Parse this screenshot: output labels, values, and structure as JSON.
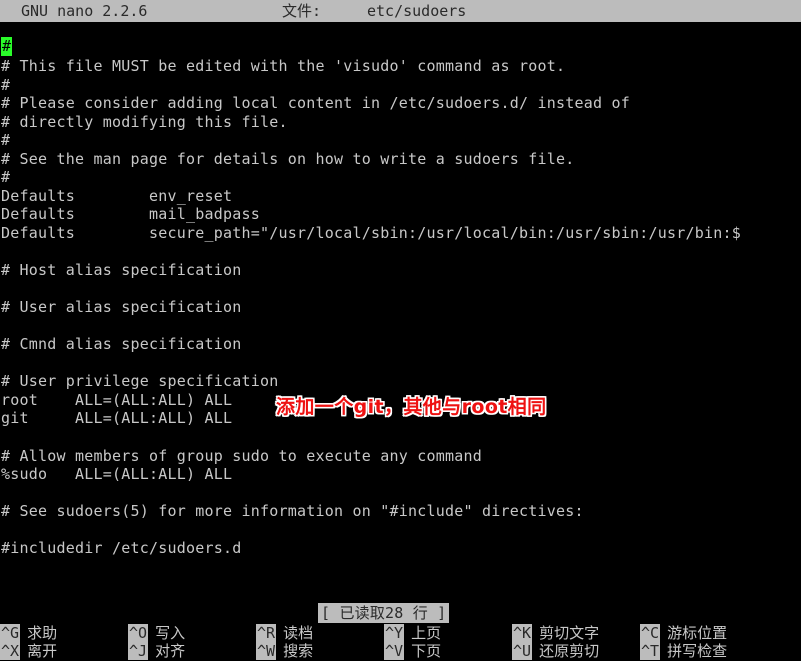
{
  "titlebar": {
    "app": "GNU nano 2.2.6",
    "file_label": "文件:",
    "filename": "etc/sudoers"
  },
  "cursor": {
    "glyph": "#",
    "color": "#2afc2a",
    "line": 1,
    "column": 1
  },
  "editor": {
    "lines": [
      "# This file MUST be edited with the 'visudo' command as root.",
      "#",
      "# Please consider adding local content in /etc/sudoers.d/ instead of",
      "# directly modifying this file.",
      "#",
      "# See the man page for details on how to write a sudoers file.",
      "#",
      "Defaults        env_reset",
      "Defaults        mail_badpass",
      "Defaults        secure_path=\"/usr/local/sbin:/usr/local/bin:/usr/sbin:/usr/bin:$",
      "",
      "# Host alias specification",
      "",
      "# User alias specification",
      "",
      "# Cmnd alias specification",
      "",
      "# User privilege specification",
      "root    ALL=(ALL:ALL) ALL",
      "git     ALL=(ALL:ALL) ALL",
      "",
      "# Allow members of group sudo to execute any command",
      "%sudo   ALL=(ALL:ALL) ALL",
      "",
      "# See sudoers(5) for more information on \"#include\" directives:",
      "",
      "#includedir /etc/sudoers.d"
    ]
  },
  "annotation": {
    "text": "添加一个git，其他与root相同",
    "color": "#ee1111",
    "outline_color": "#ffffff"
  },
  "status": {
    "message": "[ 已读取28 行 ]"
  },
  "helpbar": {
    "row1": [
      {
        "key": "^G",
        "label": "求助"
      },
      {
        "key": "^O",
        "label": "写入"
      },
      {
        "key": "^R",
        "label": "读档"
      },
      {
        "key": "^Y",
        "label": "上页"
      },
      {
        "key": "^K",
        "label": "剪切文字"
      },
      {
        "key": "^C",
        "label": "游标位置"
      }
    ],
    "row2": [
      {
        "key": "^X",
        "label": "离开"
      },
      {
        "key": "^J",
        "label": "对齐"
      },
      {
        "key": "^W",
        "label": "搜索"
      },
      {
        "key": "^V",
        "label": "下页"
      },
      {
        "key": "^U",
        "label": "还原剪切"
      },
      {
        "key": "^T",
        "label": "拼写检查"
      }
    ]
  },
  "theme": {
    "background": "#000000",
    "foreground": "#c8c8c8",
    "inverse_background": "#bcbcbc",
    "inverse_foreground": "#2a2a2a"
  }
}
